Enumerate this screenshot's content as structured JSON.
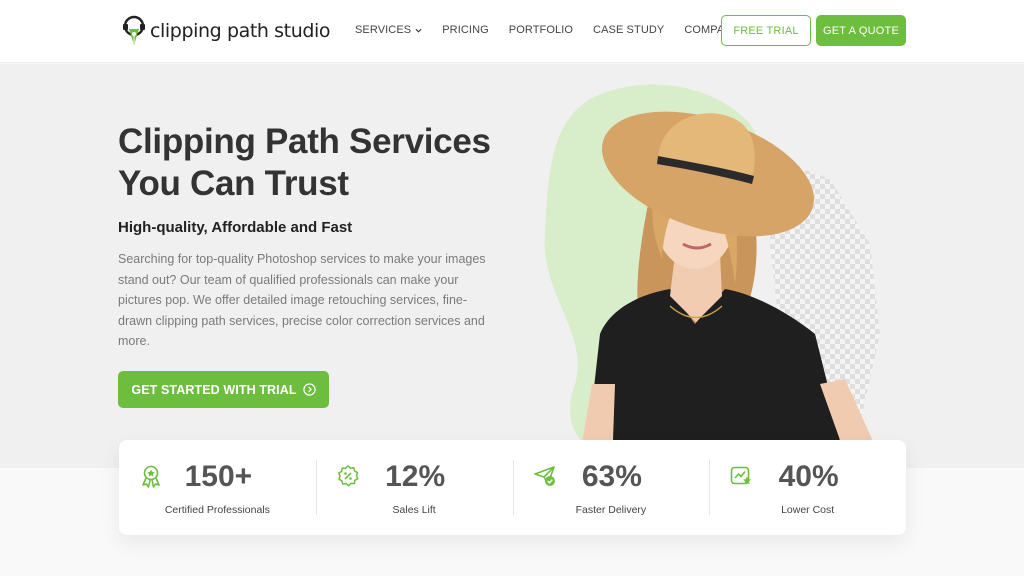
{
  "brand": {
    "name": "clipping path studio",
    "accent": "#6dbd3f"
  },
  "nav": {
    "items": [
      {
        "label": "SERVICES",
        "dropdown": true
      },
      {
        "label": "PRICING",
        "dropdown": false
      },
      {
        "label": "PORTFOLIO",
        "dropdown": false
      },
      {
        "label": "CASE STUDY",
        "dropdown": false
      },
      {
        "label": "COMPANY",
        "dropdown": true
      }
    ],
    "free_trial": "FREE TRIAL",
    "get_quote": "GET A QUOTE"
  },
  "hero": {
    "title_line1": "Clipping Path Services",
    "title_line2": "You Can Trust",
    "subtitle": "High-quality, Affordable and Fast",
    "description": "Searching for top-quality Photoshop services to make your images stand out? Our team of qualified professionals can make your pictures pop. We offer detailed image retouching services, fine-drawn clipping path services, precise color correction services and more.",
    "cta": "GET STARTED WITH TRIAL"
  },
  "stats": [
    {
      "number": "150+",
      "label": "Certified Professionals",
      "icon": "award-badge-icon"
    },
    {
      "number": "12%",
      "label": "Sales Lift",
      "icon": "discount-badge-icon"
    },
    {
      "number": "63%",
      "label": "Faster Delivery",
      "icon": "send-check-icon"
    },
    {
      "number": "40%",
      "label": "Lower Cost",
      "icon": "chart-star-icon"
    }
  ]
}
